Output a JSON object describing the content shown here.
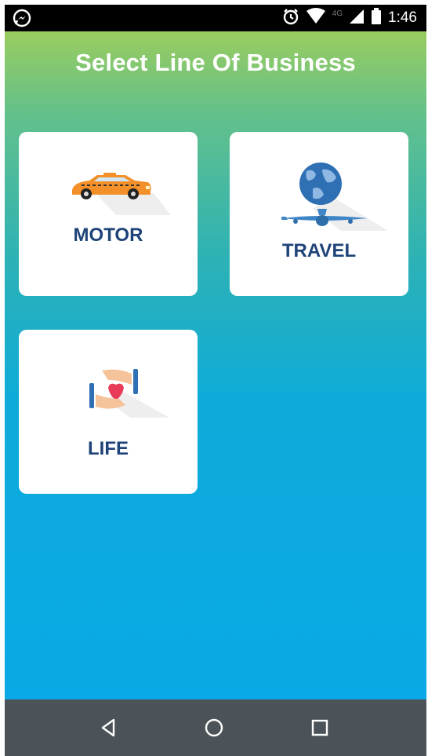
{
  "status_bar": {
    "time": "1:46",
    "network": "4G",
    "icons": [
      "messenger-icon",
      "alarm-icon",
      "wifi-icon",
      "signal-icon",
      "battery-icon"
    ]
  },
  "header": {
    "title": "Select Line Of Business"
  },
  "lines_of_business": [
    {
      "label": "MOTOR",
      "icon": "car-icon"
    },
    {
      "label": "TRAVEL",
      "icon": "globe-airplane-icon"
    },
    {
      "label": "LIFE",
      "icon": "hands-heart-icon"
    }
  ],
  "navigation": {
    "back": "back-icon",
    "home": "home-icon",
    "recents": "recents-icon"
  },
  "colors": {
    "gradient_top": "#9acc5e",
    "gradient_bottom": "#09a9e7",
    "label": "#1e4378",
    "navbar": "#4b5358"
  }
}
